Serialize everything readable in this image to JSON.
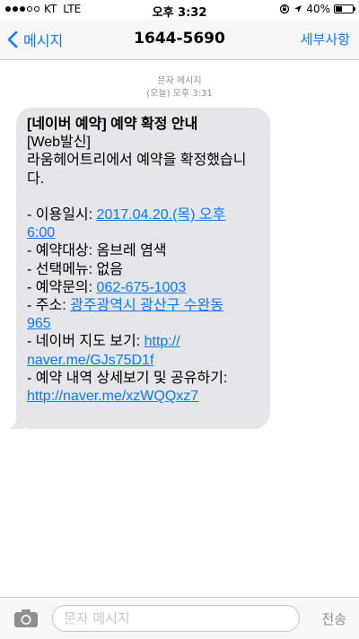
{
  "status_bar": {
    "carrier": "KT",
    "network": "LTE",
    "time": "오후 3:32",
    "battery": "40%",
    "battery_level": 0.4,
    "signal_bars": 3
  },
  "nav": {
    "back_label": "메시지",
    "title": "1644-5690",
    "details_label": "세부사항"
  },
  "message_meta": {
    "type": "문자 메시지",
    "day": "(오늘)",
    "time": "오후 3:31"
  },
  "message": {
    "lines": {
      "l1": "[네이버 예약] 예약 확정 안내",
      "l2": "[Web발신]",
      "l3": "라움헤어트리에서 예약을 확정했습니",
      "l4": "다.",
      "l6_prefix": "- 이용일시: ",
      "l6_link": "2017.04.20.(목) 오후",
      "l7_link": "6:00",
      "l8": "- 예약대상: 옴브레 염색",
      "l9": "- 선택메뉴: 없음",
      "l10_prefix": "- 예약문의: ",
      "l10_link": "062-675-1003",
      "l11_prefix": "- 주소: ",
      "l11_link": "광주광역시 광산구 수완동",
      "l12_link": "965",
      "l13_prefix": "- 네이버 지도 보기: ",
      "l13_link": "http://",
      "l14_link": "naver.me/GJs75D1f",
      "l15": "- 예약 내역 상세보기 및 공유하기:",
      "l16_link": "http://naver.me/xzWQQxz7"
    }
  },
  "input_bar": {
    "placeholder": "문자 메시지",
    "send_label": "전송"
  },
  "colors": {
    "accent": "#0a7aff",
    "bubble": "#e5e5ea"
  }
}
